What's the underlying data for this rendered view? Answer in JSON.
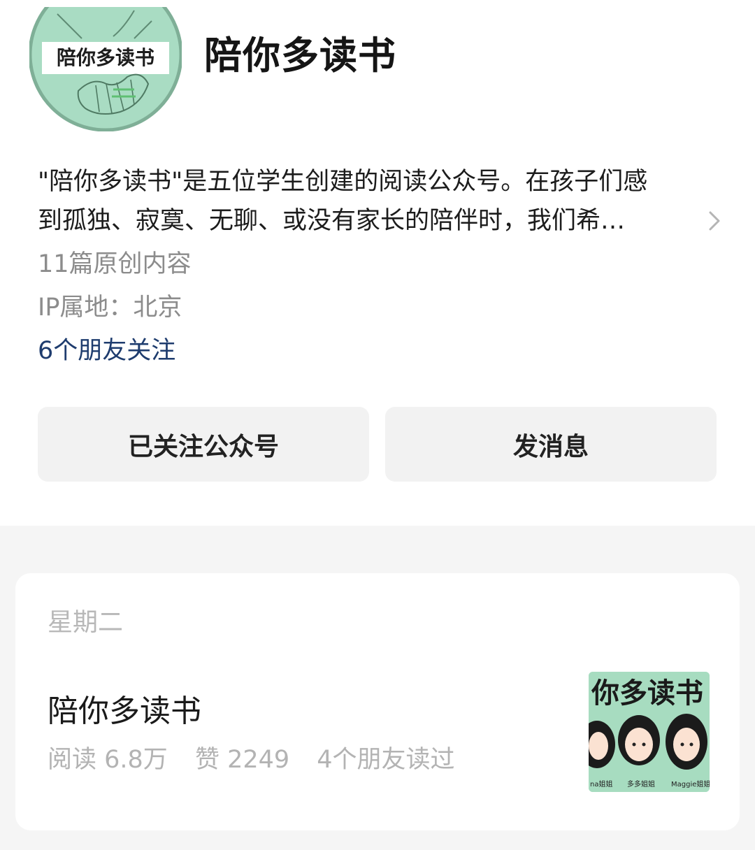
{
  "account": {
    "name": "陪你多读书",
    "logo_text": "陪你多读书",
    "intro_line1": "\"陪你多读书\"是五位学生创建的阅读公众号。在孩子们感",
    "intro_line2": "到孤独、寂寞、无聊、或没有家长的陪伴时，我们希…",
    "original_count": "11篇原创内容",
    "ip_location": "IP属地：北京",
    "friends_following": "6个朋友关注"
  },
  "actions": {
    "follow_label": "已关注公众号",
    "message_label": "发消息"
  },
  "feed": {
    "weekday": "星期二",
    "article": {
      "title": "陪你多读书",
      "reads": "阅读 6.8万",
      "likes": "赞 2249",
      "friends_read": "4个朋友读过",
      "thumb_title": "你多读书",
      "thumb_captions": [
        "na姐姐",
        "多多姐姐",
        "Maggie姐姐"
      ]
    }
  },
  "colors": {
    "logo_bg": "#a9dcc3",
    "friends_link": "#1e3c6e",
    "button_bg": "#f2f2f2",
    "feed_bg": "#f5f5f5"
  },
  "icons": [
    "chevron-right-icon",
    "hands-logo"
  ]
}
